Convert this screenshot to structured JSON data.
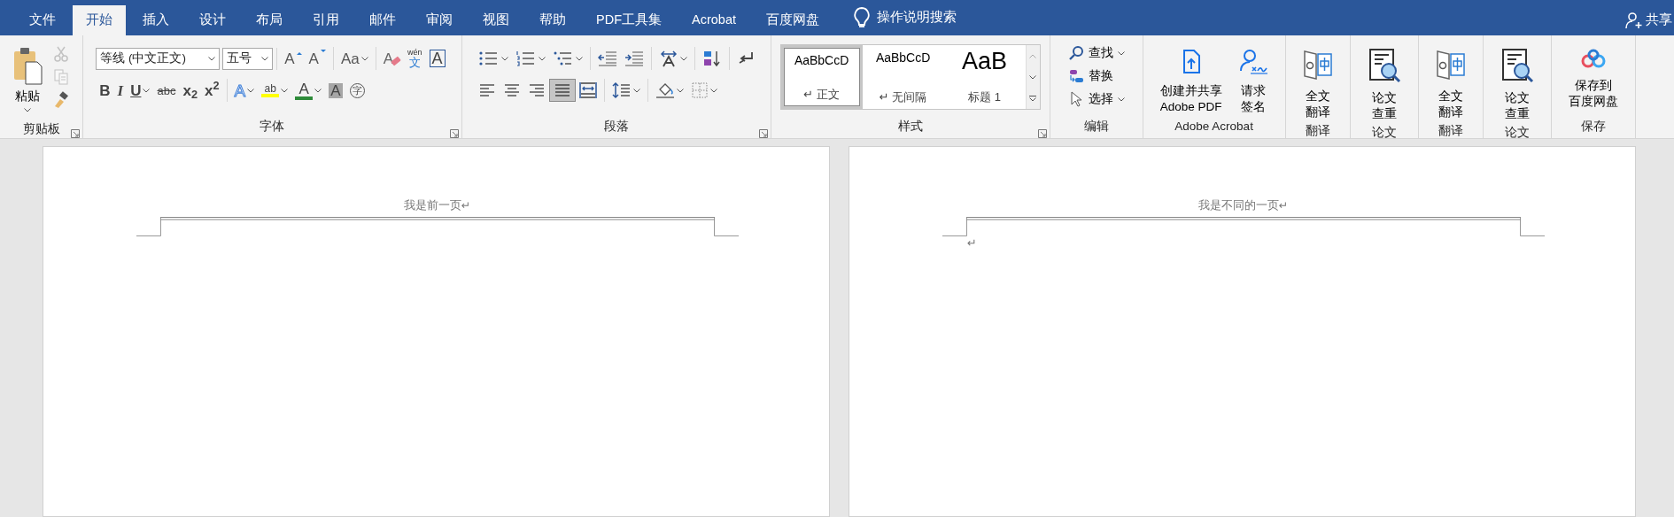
{
  "tabs": [
    {
      "label": "文件",
      "selected": false
    },
    {
      "label": "开始",
      "selected": true
    },
    {
      "label": "插入",
      "selected": false
    },
    {
      "label": "设计",
      "selected": false
    },
    {
      "label": "布局",
      "selected": false
    },
    {
      "label": "引用",
      "selected": false
    },
    {
      "label": "邮件",
      "selected": false
    },
    {
      "label": "审阅",
      "selected": false
    },
    {
      "label": "视图",
      "selected": false
    },
    {
      "label": "帮助",
      "selected": false
    },
    {
      "label": "PDF工具集",
      "selected": false
    },
    {
      "label": "Acrobat",
      "selected": false
    },
    {
      "label": "百度网盘",
      "selected": false
    }
  ],
  "tell_me": {
    "label": "操作说明搜索"
  },
  "share": {
    "label": "共享"
  },
  "ribbon": [
    {
      "kind": "clipboard",
      "label": "剪贴板",
      "launcher": true,
      "paste": {
        "label": "粘贴"
      },
      "tools": [
        {
          "kind": "cut",
          "disabled": true
        },
        {
          "kind": "copy",
          "disabled": true
        },
        {
          "kind": "format-painter",
          "disabled": false
        }
      ]
    },
    {
      "kind": "font",
      "label": "字体",
      "launcher": true,
      "font_name": "等线 (中文正文)",
      "font_size": "五号",
      "toolbars": [
        {
          "clusters": [
            {
              "buttons": [
                {
                  "kind": "grow",
                  "glyph": "A"
                },
                {
                  "kind": "shrink",
                  "glyph": "A"
                }
              ]
            },
            {
              "buttons": [
                {
                  "kind": "case",
                  "glyph": "Aa",
                  "dropdown": true
                }
              ]
            },
            {
              "buttons": [
                {
                  "kind": "clear",
                  "glyph": "A"
                },
                {
                  "kind": "phonetic",
                  "glyph": "wén",
                  "glyph2": "文"
                },
                {
                  "kind": "border",
                  "glyph": "A"
                }
              ]
            }
          ]
        },
        {
          "clusters": [
            {
              "buttons": [
                {
                  "kind": "bold",
                  "glyph": "B"
                },
                {
                  "kind": "italic",
                  "glyph": "I"
                },
                {
                  "kind": "underline",
                  "glyph": "U",
                  "dropdown": true
                },
                {
                  "kind": "strike",
                  "glyph": "abc"
                },
                {
                  "kind": "sub",
                  "glyph": "x$_{2}$"
                },
                {
                  "kind": "sup",
                  "glyph": "x$^{2}$"
                }
              ]
            },
            {
              "buttons": [
                {
                  "kind": "effect",
                  "glyph": "A",
                  "dropdown": true
                },
                {
                  "kind": "highlight",
                  "glyph": "ab",
                  "dropdown": true
                },
                {
                  "kind": "color",
                  "glyph": "A",
                  "dropdown": true
                },
                {
                  "kind": "shade",
                  "glyph": "A"
                },
                {
                  "kind": "enclose",
                  "glyph": "字"
                }
              ]
            }
          ]
        }
      ]
    },
    {
      "kind": "paragraph",
      "label": "段落",
      "launcher": true,
      "toolbars": [
        {
          "clusters": [
            {
              "buttons": [
                {
                  "kind": "bullets",
                  "dropdown": true
                },
                {
                  "kind": "numbering",
                  "dropdown": true
                },
                {
                  "kind": "multilevel",
                  "dropdown": true
                }
              ]
            },
            {
              "buttons": [
                {
                  "kind": "outdent"
                },
                {
                  "kind": "indent"
                }
              ]
            },
            {
              "buttons": [
                {
                  "kind": "asian",
                  "dropdown": true
                }
              ]
            },
            {
              "buttons": [
                {
                  "kind": "sort"
                }
              ]
            },
            {
              "buttons": [
                {
                  "kind": "marks"
                }
              ]
            }
          ]
        },
        {
          "clusters": [
            {
              "buttons": [
                {
                  "kind": "align-left",
                  "selected": false
                },
                {
                  "kind": "align-center",
                  "selected": false
                },
                {
                  "kind": "align-right",
                  "selected": false
                },
                {
                  "kind": "justify",
                  "selected": true
                },
                {
                  "kind": "distribute",
                  "selected": false
                }
              ]
            },
            {
              "buttons": [
                {
                  "kind": "line-spacing",
                  "dropdown": true
                }
              ]
            },
            {
              "buttons": [
                {
                  "kind": "shading",
                  "dropdown": true
                },
                {
                  "kind": "borders",
                  "dropdown": true
                }
              ]
            }
          ]
        }
      ]
    },
    {
      "kind": "styles",
      "label": "样式",
      "launcher": true,
      "items": [
        {
          "kind": "normal",
          "preview": "AaBbCcD",
          "mark": "↵",
          "label": "正文",
          "selected": true
        },
        {
          "kind": "normal",
          "preview": "AaBbCcD",
          "mark": "↵",
          "label": "无间隔",
          "selected": false
        },
        {
          "kind": "heading",
          "preview": "AaB",
          "label": "标题 1",
          "selected": false
        }
      ]
    },
    {
      "kind": "editing",
      "label": "编辑",
      "items": [
        {
          "kind": "find",
          "label": "查找",
          "dropdown": true
        },
        {
          "kind": "replace",
          "label": "替换"
        },
        {
          "kind": "select",
          "label": "选择",
          "dropdown": true
        }
      ]
    },
    {
      "kind": "large",
      "label": "Adobe Acrobat",
      "buttons": [
        {
          "kind": "pdf-share",
          "lines": [
            "创建并共享",
            "Adobe PDF"
          ]
        },
        {
          "kind": "signature",
          "lines": [
            "请求",
            "签名"
          ]
        }
      ]
    },
    {
      "kind": "large",
      "label": "翻译",
      "buttons": [
        {
          "kind": "translate",
          "lines": [
            "全文",
            "翻译"
          ]
        }
      ]
    },
    {
      "kind": "large",
      "label": "论文",
      "buttons": [
        {
          "kind": "paper-check",
          "lines": [
            "论文",
            "查重"
          ]
        }
      ]
    },
    {
      "kind": "large",
      "label": "翻译",
      "buttons": [
        {
          "kind": "translate",
          "lines": [
            "全文",
            "翻译"
          ]
        }
      ]
    },
    {
      "kind": "large",
      "label": "论文",
      "buttons": [
        {
          "kind": "paper-check",
          "lines": [
            "论文",
            "查重"
          ]
        }
      ]
    },
    {
      "kind": "large",
      "label": "保存",
      "buttons": [
        {
          "kind": "cloud",
          "lines": [
            "保存到",
            "百度网盘"
          ]
        }
      ]
    }
  ],
  "pages": [
    {
      "header": "我是前一页↵"
    },
    {
      "header": "我是不同的一页↵",
      "body": "↵"
    }
  ]
}
